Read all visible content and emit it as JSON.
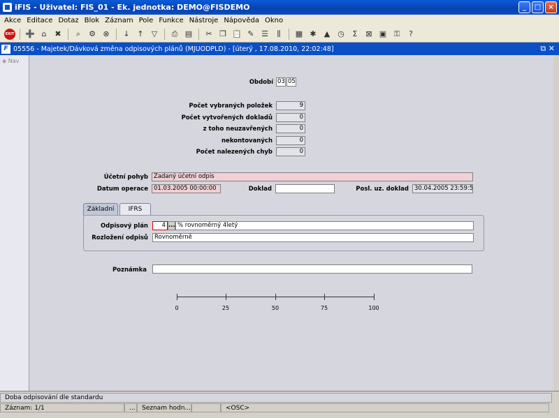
{
  "window": {
    "title": "iFIS - Uživatel: FIS_01 - Ek. jednotka: DEMO@FISDEMO"
  },
  "menu": [
    "Akce",
    "Editace",
    "Dotaz",
    "Blok",
    "Záznam",
    "Pole",
    "Funkce",
    "Nástroje",
    "Nápověda",
    "Okno"
  ],
  "toolbar": {
    "exit_label": "EXIT"
  },
  "form": {
    "title": "05556 - Majetek/Dávková změna odpisových plánů (MJUODPLD) - [úterý , 17.08.2010, 22:02:48]"
  },
  "nav": {
    "label": "Nav"
  },
  "period": {
    "label": "Období",
    "month": "03",
    "year": "05"
  },
  "counts": [
    {
      "label": "Počet vybraných položek",
      "value": "9"
    },
    {
      "label": "Počet vytvořených dokladů",
      "value": "0"
    },
    {
      "label": "z toho  neuzavřených",
      "value": "0"
    },
    {
      "label": "nekontovaných",
      "value": "0"
    },
    {
      "label": "Počet nalezených chyb",
      "value": "0"
    }
  ],
  "movement": {
    "label": "Účetní pohyb",
    "value": "Zadaný účetní odpis"
  },
  "op_date": {
    "label": "Datum operace",
    "value": "01.03.2005 00:00:00"
  },
  "doc": {
    "label": "Doklad",
    "value": ""
  },
  "last_doc": {
    "label": "Posl. uz. doklad",
    "value": "30.04.2005 23:59:55"
  },
  "tabs": [
    "Základní",
    "IFRS"
  ],
  "plan": {
    "label": "Odpisový plán",
    "code": "4",
    "lov": "...",
    "desc": "% rovnoměrný 4letý"
  },
  "distribution": {
    "label": "Rozložení odpisů",
    "value": "Rovnoměrně"
  },
  "note": {
    "label": "Poznámka",
    "value": ""
  },
  "scale": [
    0,
    25,
    50,
    75,
    100
  ],
  "status": {
    "message": "Doba odpisování dle standardu",
    "record": "Záznam: 1/1",
    "dots": "...",
    "list": "Seznam hodn...",
    "osc": "<OSC>"
  }
}
